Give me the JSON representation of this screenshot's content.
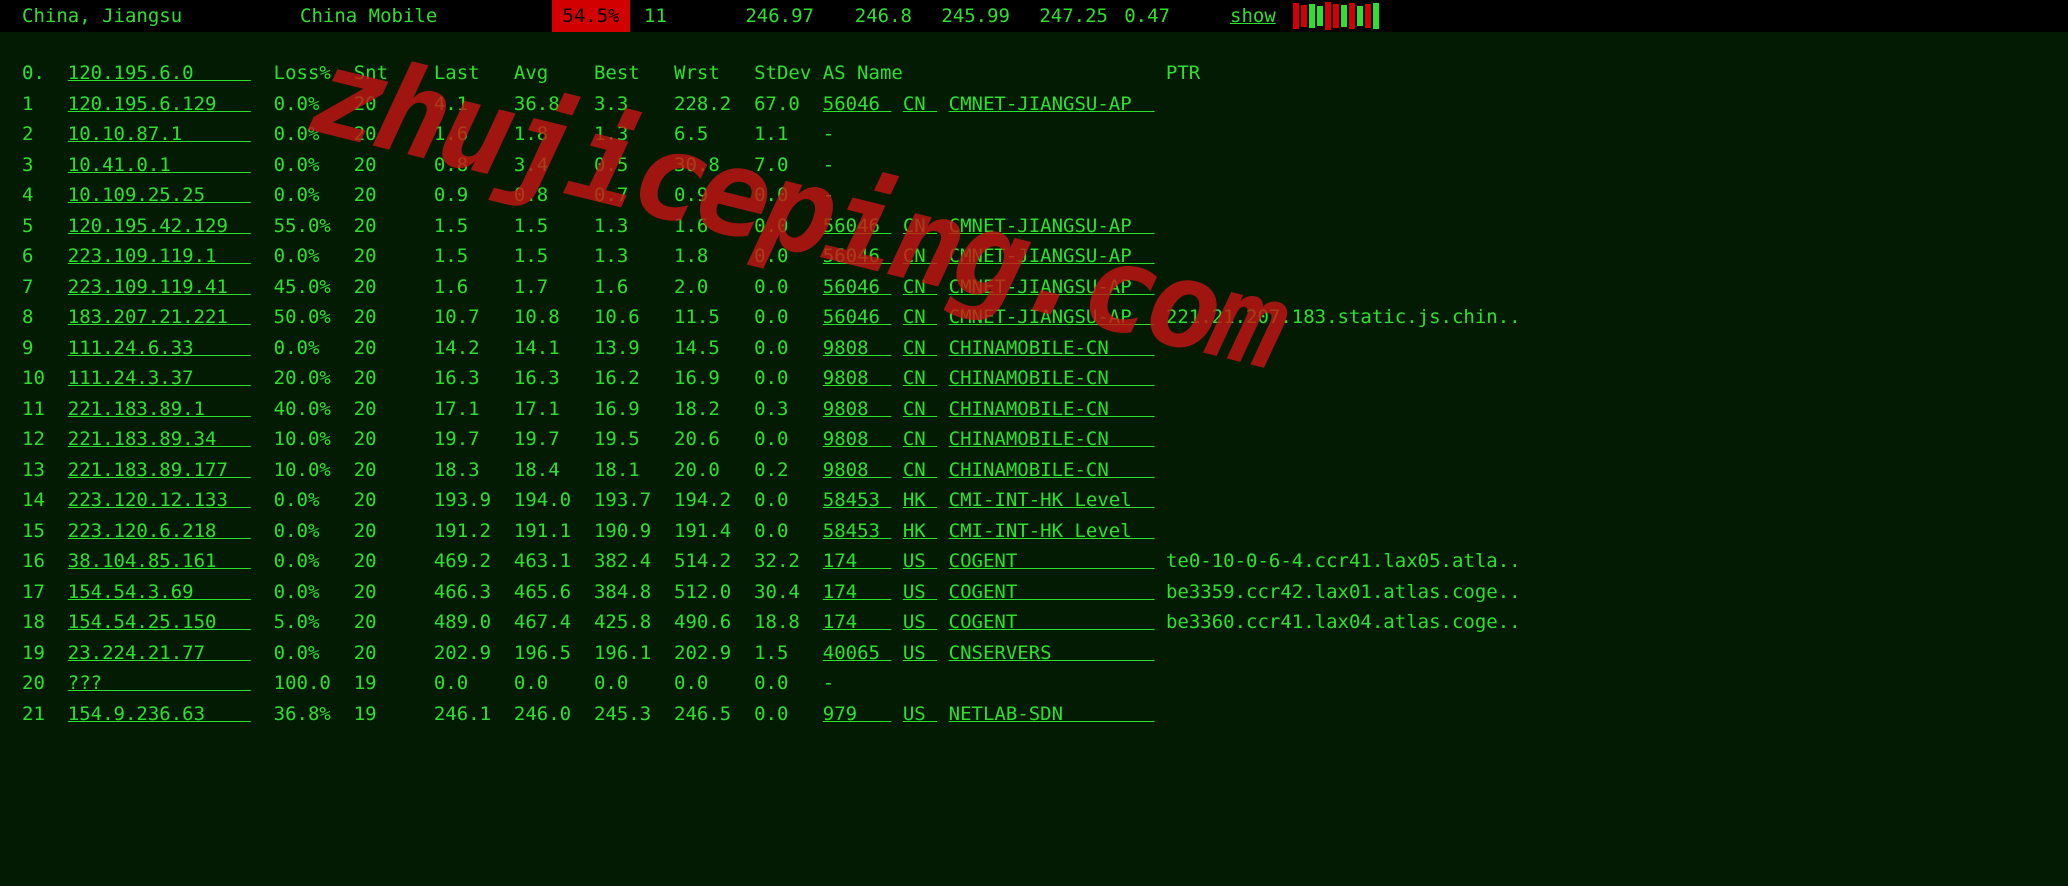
{
  "topbar": {
    "location": "China, Jiangsu",
    "isp": "China Mobile",
    "loss_pct": "54.5%",
    "sent": "11",
    "last": "246.97",
    "avg": "246.8",
    "best": "245.99",
    "worst": "247.25",
    "stdev": "0.47",
    "show": "show"
  },
  "columns": [
    "",
    "",
    "Loss%",
    "Snt",
    "Last",
    "Avg",
    "Best",
    "Wrst",
    "StDev",
    "AS Name",
    "PTR"
  ],
  "header_hop": "0.",
  "header_ip": "120.195.6.0",
  "rows": [
    {
      "n": "1",
      "ip": "120.195.6.129",
      "loss": "0.0%",
      "snt": "20",
      "last": "4.1",
      "avg": "36.8",
      "best": "3.3",
      "wrst": "228.2",
      "stdev": "67.0",
      "as": "56046",
      "cc": "CN",
      "asname": "CMNET-JIANGSU-AP",
      "ptr": ""
    },
    {
      "n": "2",
      "ip": "10.10.87.1",
      "loss": "0.0%",
      "snt": "20",
      "last": "1.6",
      "avg": "1.8",
      "best": "1.3",
      "wrst": "6.5",
      "stdev": "1.1",
      "as": "",
      "cc": "",
      "asname": "-",
      "ptr": ""
    },
    {
      "n": "3",
      "ip": "10.41.0.1",
      "loss": "0.0%",
      "snt": "20",
      "last": "0.8",
      "avg": "3.4",
      "best": "0.5",
      "wrst": "30.8",
      "stdev": "7.0",
      "as": "",
      "cc": "",
      "asname": "-",
      "ptr": ""
    },
    {
      "n": "4",
      "ip": "10.109.25.25",
      "loss": "0.0%",
      "snt": "20",
      "last": "0.9",
      "avg": "0.8",
      "best": "0.7",
      "wrst": "0.9",
      "stdev": "0.0",
      "as": "",
      "cc": "",
      "asname": "-",
      "ptr": ""
    },
    {
      "n": "5",
      "ip": "120.195.42.129",
      "loss": "55.0%",
      "snt": "20",
      "last": "1.5",
      "avg": "1.5",
      "best": "1.3",
      "wrst": "1.6",
      "stdev": "0.0",
      "as": "56046",
      "cc": "CN",
      "asname": "CMNET-JIANGSU-AP",
      "ptr": ""
    },
    {
      "n": "6",
      "ip": "223.109.119.1",
      "loss": "0.0%",
      "snt": "20",
      "last": "1.5",
      "avg": "1.5",
      "best": "1.3",
      "wrst": "1.8",
      "stdev": "0.0",
      "as": "56046",
      "cc": "CN",
      "asname": "CMNET-JIANGSU-AP",
      "ptr": ""
    },
    {
      "n": "7",
      "ip": "223.109.119.41",
      "loss": "45.0%",
      "snt": "20",
      "last": "1.6",
      "avg": "1.7",
      "best": "1.6",
      "wrst": "2.0",
      "stdev": "0.0",
      "as": "56046",
      "cc": "CN",
      "asname": "CMNET-JIANGSU-AP",
      "ptr": ""
    },
    {
      "n": "8",
      "ip": "183.207.21.221",
      "loss": "50.0%",
      "snt": "20",
      "last": "10.7",
      "avg": "10.8",
      "best": "10.6",
      "wrst": "11.5",
      "stdev": "0.0",
      "as": "56046",
      "cc": "CN",
      "asname": "CMNET-JIANGSU-AP",
      "ptr": "221.21.207.183.static.js.chin.."
    },
    {
      "n": "9",
      "ip": "111.24.6.33",
      "loss": "0.0%",
      "snt": "20",
      "last": "14.2",
      "avg": "14.1",
      "best": "13.9",
      "wrst": "14.5",
      "stdev": "0.0",
      "as": "9808",
      "cc": "CN",
      "asname": "CHINAMOBILE-CN",
      "ptr": ""
    },
    {
      "n": "10",
      "ip": "111.24.3.37",
      "loss": "20.0%",
      "snt": "20",
      "last": "16.3",
      "avg": "16.3",
      "best": "16.2",
      "wrst": "16.9",
      "stdev": "0.0",
      "as": "9808",
      "cc": "CN",
      "asname": "CHINAMOBILE-CN",
      "ptr": ""
    },
    {
      "n": "11",
      "ip": "221.183.89.1",
      "loss": "40.0%",
      "snt": "20",
      "last": "17.1",
      "avg": "17.1",
      "best": "16.9",
      "wrst": "18.2",
      "stdev": "0.3",
      "as": "9808",
      "cc": "CN",
      "asname": "CHINAMOBILE-CN",
      "ptr": ""
    },
    {
      "n": "12",
      "ip": "221.183.89.34",
      "loss": "10.0%",
      "snt": "20",
      "last": "19.7",
      "avg": "19.7",
      "best": "19.5",
      "wrst": "20.6",
      "stdev": "0.0",
      "as": "9808",
      "cc": "CN",
      "asname": "CHINAMOBILE-CN",
      "ptr": ""
    },
    {
      "n": "13",
      "ip": "221.183.89.177",
      "loss": "10.0%",
      "snt": "20",
      "last": "18.3",
      "avg": "18.4",
      "best": "18.1",
      "wrst": "20.0",
      "stdev": "0.2",
      "as": "9808",
      "cc": "CN",
      "asname": "CHINAMOBILE-CN",
      "ptr": ""
    },
    {
      "n": "14",
      "ip": "223.120.12.133",
      "loss": "0.0%",
      "snt": "20",
      "last": "193.9",
      "avg": "194.0",
      "best": "193.7",
      "wrst": "194.2",
      "stdev": "0.0",
      "as": "58453",
      "cc": "HK",
      "asname": "CMI-INT-HK Level",
      "ptr": ""
    },
    {
      "n": "15",
      "ip": "223.120.6.218",
      "loss": "0.0%",
      "snt": "20",
      "last": "191.2",
      "avg": "191.1",
      "best": "190.9",
      "wrst": "191.4",
      "stdev": "0.0",
      "as": "58453",
      "cc": "HK",
      "asname": "CMI-INT-HK Level",
      "ptr": ""
    },
    {
      "n": "16",
      "ip": "38.104.85.161",
      "loss": "0.0%",
      "snt": "20",
      "last": "469.2",
      "avg": "463.1",
      "best": "382.4",
      "wrst": "514.2",
      "stdev": "32.2",
      "as": "174",
      "cc": "US",
      "asname": "COGENT",
      "ptr": "te0-10-0-6-4.ccr41.lax05.atla.."
    },
    {
      "n": "17",
      "ip": "154.54.3.69",
      "loss": "0.0%",
      "snt": "20",
      "last": "466.3",
      "avg": "465.6",
      "best": "384.8",
      "wrst": "512.0",
      "stdev": "30.4",
      "as": "174",
      "cc": "US",
      "asname": "COGENT",
      "ptr": "be3359.ccr42.lax01.atlas.coge.."
    },
    {
      "n": "18",
      "ip": "154.54.25.150",
      "loss": "5.0%",
      "snt": "20",
      "last": "489.0",
      "avg": "467.4",
      "best": "425.8",
      "wrst": "490.6",
      "stdev": "18.8",
      "as": "174",
      "cc": "US",
      "asname": "COGENT",
      "ptr": "be3360.ccr41.lax04.atlas.coge.."
    },
    {
      "n": "19",
      "ip": "23.224.21.77",
      "loss": "0.0%",
      "snt": "20",
      "last": "202.9",
      "avg": "196.5",
      "best": "196.1",
      "wrst": "202.9",
      "stdev": "1.5",
      "as": "40065",
      "cc": "US",
      "asname": "CNSERVERS",
      "ptr": ""
    },
    {
      "n": "20",
      "ip": "???",
      "loss": "100.0",
      "snt": "19",
      "last": "0.0",
      "avg": "0.0",
      "best": "0.0",
      "wrst": "0.0",
      "stdev": "0.0",
      "as": "",
      "cc": "",
      "asname": "-",
      "ptr": ""
    },
    {
      "n": "21",
      "ip": "154.9.236.63",
      "loss": "36.8%",
      "snt": "19",
      "last": "246.1",
      "avg": "246.0",
      "best": "245.3",
      "wrst": "246.5",
      "stdev": "0.0",
      "as": "979",
      "cc": "US",
      "asname": "NETLAB-SDN",
      "ptr": ""
    }
  ],
  "watermark": "zhujiceping.com"
}
